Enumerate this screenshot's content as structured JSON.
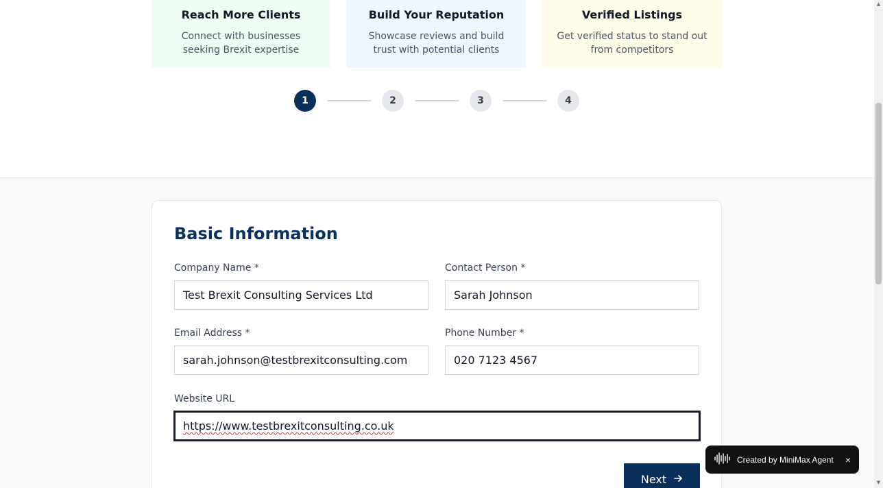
{
  "features": [
    {
      "title": "Reach More Clients",
      "description": "Connect with businesses seeking Brexit expertise"
    },
    {
      "title": "Build Your Reputation",
      "description": "Showcase reviews and build trust with potential clients"
    },
    {
      "title": "Verified Listings",
      "description": "Get verified status to stand out from competitors"
    }
  ],
  "stepper": {
    "steps": [
      "1",
      "2",
      "3",
      "4"
    ],
    "active_step": 1
  },
  "form": {
    "title": "Basic Information",
    "fields": {
      "company_name": {
        "label": "Company Name *",
        "value": "Test Brexit Consulting Services Ltd"
      },
      "contact_person": {
        "label": "Contact Person *",
        "value": "Sarah Johnson"
      },
      "email": {
        "label": "Email Address *",
        "value": "sarah.johnson@testbrexitconsulting.com"
      },
      "phone": {
        "label": "Phone Number *",
        "value": "020 7123 4567"
      },
      "website": {
        "label": "Website URL",
        "value": "https://www.testbrexitconsulting.co.uk"
      }
    },
    "next_label": "Next",
    "next_icon": "arrow-right-icon"
  },
  "badge": {
    "label": "Created by MiniMax Agent",
    "close": "×",
    "icon": "audio-waveform-icon"
  },
  "colors": {
    "primary": "#0b2f5b",
    "feature_green": "#f0fdf4",
    "feature_blue": "#eff6ff",
    "feature_yellow": "#fefce8"
  }
}
